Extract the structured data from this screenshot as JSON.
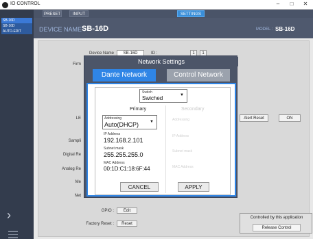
{
  "window": {
    "title": "IO CONTROL",
    "controls": {
      "minimize": "–",
      "maximize": "□",
      "close": "✕"
    }
  },
  "sidebar": {
    "devices": [
      "SB-16D",
      "SB-16D",
      "AUTO-EDIT"
    ],
    "chevron": "›"
  },
  "header": {
    "tabs": [
      "PRESET",
      "INPUT",
      "SETTINGS"
    ],
    "active_tab": "SETTINGS",
    "device_name_label": "DEVICE NAME :",
    "device_name": "SB-16D",
    "model_label": "MODEL :",
    "model": "SB-16D"
  },
  "background": {
    "device_name_label": "Device Name",
    "device_name_value": "SB-16D",
    "id_label": "ID :",
    "id_values": [
      "1",
      "1"
    ],
    "firmware_label": "Firm",
    "alert_reset": "Alert Reset",
    "on_button": "ON",
    "row_labels": [
      "LE",
      "Sampli",
      "Digital Re",
      "Analog Re",
      "Me",
      "Net"
    ],
    "gpio_label": "GPIO :",
    "gpio_button": "Edit",
    "factory_reset_label": "Factory Reset :",
    "factory_reset_button": "Reset",
    "controlled_by": "Controlled by this application",
    "release_control": "Release Control"
  },
  "dialog": {
    "title": "Network Settings",
    "tab_dante": "Dante Network",
    "tab_control": "Control Network",
    "switch_label": "Switch",
    "switch_value": "Swiched",
    "primary_header": "Primary",
    "secondary_header": "Secondary",
    "addressing_label": "Addressing",
    "addressing_value": "Auto(DHCP)",
    "ip_label": "IP Address",
    "ip_value": "192.168.2.101",
    "subnet_label": "Subnet mask",
    "subnet_value": "255.255.255.0",
    "mac_label": "MAC Address",
    "mac_value": "00:1D:C1:18:6F:44",
    "sec_addressing_label": "Addressing",
    "sec_ip_label": "IP Address",
    "sec_subnet_label": "Subnet mask",
    "sec_mac_label": "MAC Address",
    "cancel": "CANCEL",
    "apply": "APPLY"
  },
  "colors": {
    "accent": "#2f85e6",
    "sidebar_bg": "#333c4d",
    "header_bg": "#4f596e",
    "dialog_bg": "#4c5568"
  }
}
